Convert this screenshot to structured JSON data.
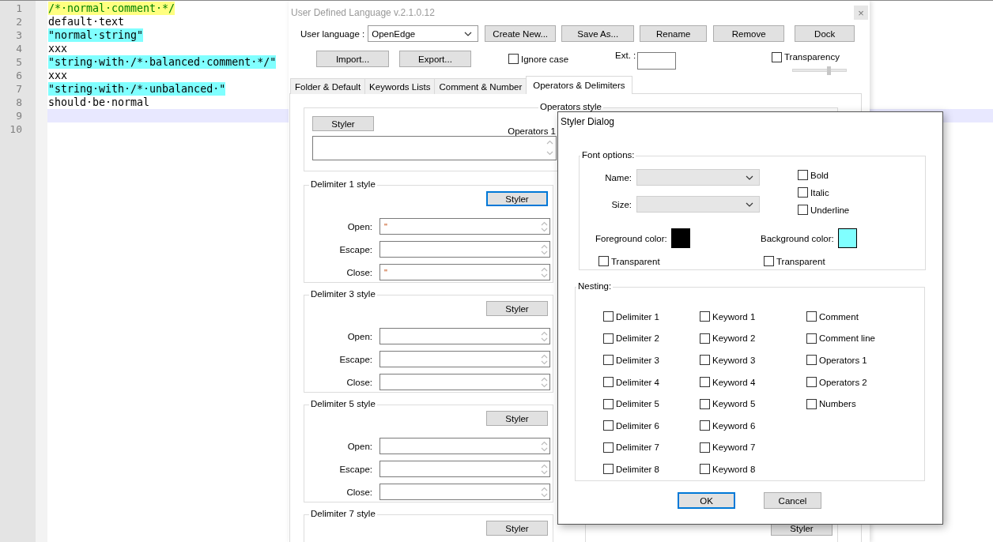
{
  "editor": {
    "lines": [
      {
        "number": "1",
        "text": "/*·normal·comment·*/",
        "kind": "comment",
        "current": false
      },
      {
        "number": "2",
        "text": "default·text",
        "kind": "default",
        "current": false
      },
      {
        "number": "3",
        "text": "\"normal·string\"",
        "kind": "string",
        "current": false
      },
      {
        "number": "4",
        "text": "xxx",
        "kind": "default",
        "current": false
      },
      {
        "number": "5",
        "text": "\"string·with·/*·balanced·comment·*/\"",
        "kind": "string",
        "current": false
      },
      {
        "number": "6",
        "text": "xxx",
        "kind": "default",
        "current": false
      },
      {
        "number": "7",
        "text": "\"string·with·/*·unbalanced·\"",
        "kind": "string",
        "current": false
      },
      {
        "number": "8",
        "text": "should·be·normal",
        "kind": "default",
        "current": false
      },
      {
        "number": "9",
        "current": true
      },
      {
        "number": "10",
        "current": false
      }
    ]
  },
  "udl": {
    "title": "User Defined Language v.2.1.0.12",
    "close": "×",
    "language_label": "User language :",
    "language": "OpenEdge",
    "buttons": [
      "Create New...",
      "Save As...",
      "Rename",
      "Remove",
      "Dock"
    ],
    "import": "Import...",
    "export": "Export...",
    "ignore_case": {
      "label": "Ignore case",
      "checked": false
    },
    "ext_label": "Ext. :",
    "transparency": {
      "label": "Transparency",
      "checked": false,
      "level": 0.68
    },
    "tabs": [
      {
        "label": "Folder & Default",
        "selected": false
      },
      {
        "label": "Keywords Lists",
        "selected": false
      },
      {
        "label": "Comment & Number",
        "selected": false
      },
      {
        "label": "Operators & Delimiters",
        "selected": true
      }
    ],
    "operators": {
      "legend": "Operators style",
      "styler": "Styler",
      "label": "Operators 1"
    },
    "delimiters": [
      {
        "legend": "Delimiter 1 style",
        "styler": "Styler",
        "focused": true,
        "fields": [
          {
            "label": "Open:",
            "value": "\""
          },
          {
            "label": "Escape:"
          },
          {
            "label": "Close:",
            "value": "\""
          }
        ]
      },
      {
        "legend": "Delimiter 3 style",
        "styler": "Styler",
        "focused": false,
        "fields": [
          {
            "label": "Open:"
          },
          {
            "label": "Escape:"
          },
          {
            "label": "Close:"
          }
        ]
      },
      {
        "legend": "Delimiter 5 style",
        "styler": "Styler",
        "focused": false,
        "fields": [
          {
            "label": "Open:"
          },
          {
            "label": "Escape:"
          },
          {
            "label": "Close:"
          }
        ]
      },
      {
        "legend": "Delimiter 7 style",
        "styler": "Styler",
        "focused": false
      }
    ],
    "right_styler": "Styler"
  },
  "styler": {
    "title": "Styler Dialog",
    "font_legend": "Font options:",
    "name_label": "Name:",
    "size_label": "Size:",
    "styles": [
      {
        "label": "Bold",
        "checked": false
      },
      {
        "label": "Italic",
        "checked": false
      },
      {
        "label": "Underline",
        "checked": false
      }
    ],
    "foreground": {
      "label": "Foreground color:",
      "color": "#000000",
      "transparent": {
        "label": "Transparent",
        "checked": false
      }
    },
    "background": {
      "label": "Background color:",
      "color": "#80ffff",
      "transparent": {
        "label": "Transparent",
        "checked": false
      }
    },
    "nesting_legend": "Nesting:",
    "nesting_columns": [
      {
        "items": [
          {
            "label": "Delimiter 1",
            "checked": false
          },
          {
            "label": "Delimiter 2",
            "checked": false
          },
          {
            "label": "Delimiter 3",
            "checked": false
          },
          {
            "label": "Delimiter 4",
            "checked": false
          },
          {
            "label": "Delimiter 5",
            "checked": false
          },
          {
            "label": "Delimiter 6",
            "checked": false
          },
          {
            "label": "Delimiter 7",
            "checked": false
          },
          {
            "label": "Delimiter 8",
            "checked": false
          }
        ]
      },
      {
        "items": [
          {
            "label": "Keyword 1",
            "checked": false
          },
          {
            "label": "Keyword 2",
            "checked": false
          },
          {
            "label": "Keyword 3",
            "checked": false
          },
          {
            "label": "Keyword 4",
            "checked": false
          },
          {
            "label": "Keyword 5",
            "checked": false
          },
          {
            "label": "Keyword 6",
            "checked": false
          },
          {
            "label": "Keyword 7",
            "checked": false
          },
          {
            "label": "Keyword 8",
            "checked": false
          }
        ]
      },
      {
        "items": [
          {
            "label": "Comment",
            "checked": false
          },
          {
            "label": "Comment line",
            "checked": false
          },
          {
            "label": "Operators 1",
            "checked": false
          },
          {
            "label": "Operators 2",
            "checked": false
          },
          {
            "label": "Numbers",
            "checked": false
          }
        ]
      }
    ],
    "ok": "OK",
    "cancel": "Cancel"
  }
}
